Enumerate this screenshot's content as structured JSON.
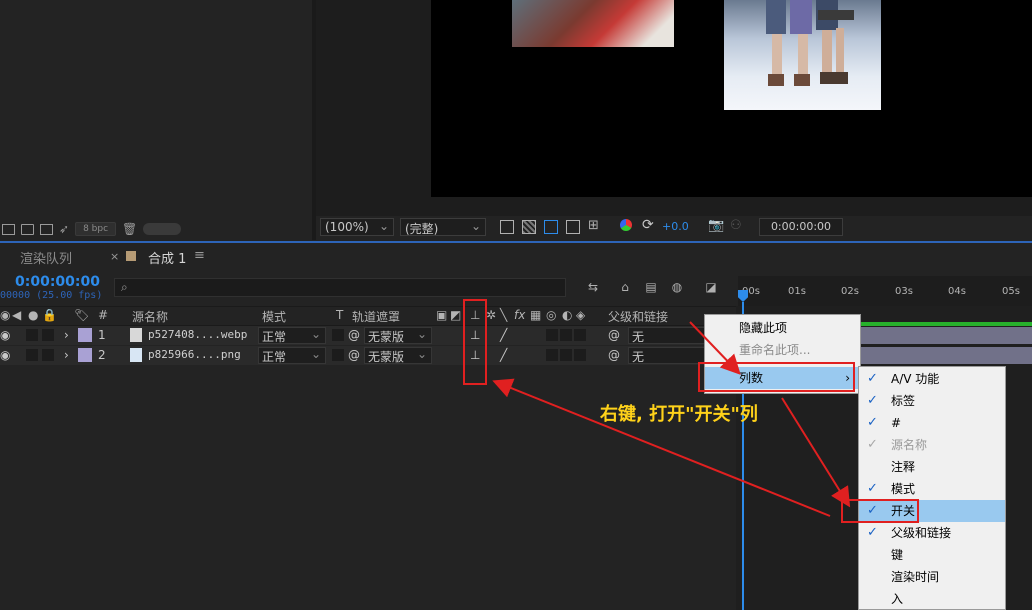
{
  "project_toolbar": {
    "bpc": "8 bpc"
  },
  "viewer": {
    "zoom": "(100%)",
    "resolution": "(完整)",
    "exposure": "+0.0",
    "timecode": "0:00:00:00"
  },
  "tabs": {
    "render_queue": "渲染队列",
    "comp": "合成 1",
    "comp_close": "×",
    "comp_menu": "≡"
  },
  "timeline": {
    "timecode": "0:00:00:00",
    "frames": "00000 (25.00 fps)",
    "search_icon": "⌕",
    "headers": {
      "hash": "#",
      "source_name": "源名称",
      "mode": "模式",
      "t": "T",
      "track_matte": "轨道遮罩",
      "parent": "父级和链接"
    },
    "layers": [
      {
        "num": "1",
        "name": "p527408....webp",
        "mode": "正常",
        "matte": "无蒙版",
        "parent": "无"
      },
      {
        "num": "2",
        "name": "p825966....png",
        "mode": "正常",
        "matte": "无蒙版",
        "parent": "无"
      }
    ],
    "ruler": [
      "00s",
      "01s",
      "02s",
      "03s",
      "04s",
      "05s"
    ]
  },
  "context_menu": {
    "items": [
      {
        "label": "隐藏此项",
        "disabled": false
      },
      {
        "label": "重命名此项...",
        "disabled": true
      },
      {
        "label": "列数",
        "disabled": false,
        "submenu": "›"
      }
    ]
  },
  "columns_submenu": {
    "items": [
      {
        "label": "A/V 功能",
        "checked": true
      },
      {
        "label": "标签",
        "checked": true
      },
      {
        "label": "#",
        "checked": true
      },
      {
        "label": "源名称",
        "checked": true,
        "disabled": true
      },
      {
        "label": "注释",
        "checked": false
      },
      {
        "label": "模式",
        "checked": true
      },
      {
        "label": "开关",
        "checked": true,
        "selected": true
      },
      {
        "label": "父级和链接",
        "checked": true
      },
      {
        "label": "键",
        "checked": false
      },
      {
        "label": "渲染时间",
        "checked": false
      },
      {
        "label": "入",
        "checked": false
      }
    ],
    "check_glyph": "✓"
  },
  "annotation": {
    "text": "右键, 打开\"开关\"列",
    "color": "#ffd21a",
    "highlight_color": "#e02020"
  },
  "colors": {
    "accent_blue": "#2d8ceb",
    "label_swatch": "#a9a1d4",
    "layer_bar": "#717189",
    "work_area": "#27b12c"
  }
}
